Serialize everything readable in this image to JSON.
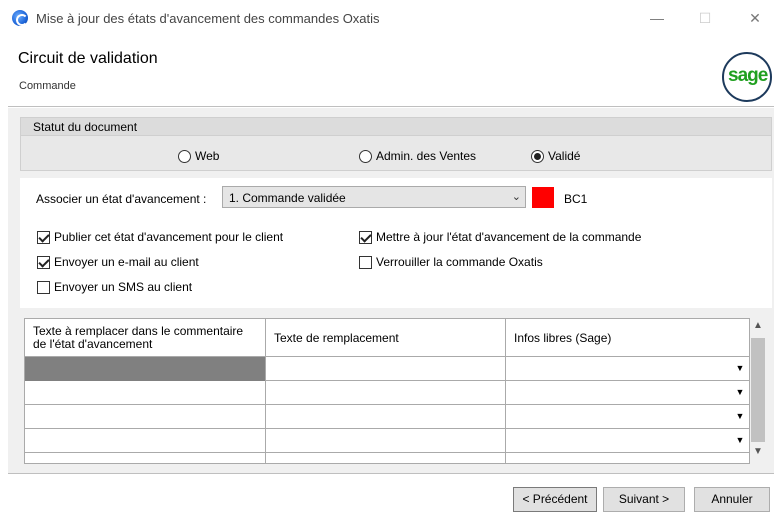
{
  "window": {
    "title": "Mise à jour des états d'avancement des commandes Oxatis",
    "minimize": "—",
    "maximize": "☐",
    "close": "✕"
  },
  "header": {
    "title": "Circuit de validation",
    "subtitle": "Commande",
    "logo_text": "sage"
  },
  "status": {
    "heading": "Statut du document",
    "options": [
      {
        "label": "Web",
        "checked": false
      },
      {
        "label": "Admin. des Ventes",
        "checked": false
      },
      {
        "label": "Validé",
        "checked": true
      }
    ]
  },
  "associate": {
    "label": "Associer un état d'avancement :",
    "selected": "1. Commande validée",
    "color": "#ff0000",
    "code": "BC1"
  },
  "options": {
    "publish": {
      "label": "Publier cet état d'avancement pour le client",
      "checked": true
    },
    "update": {
      "label": "Mettre à jour l'état d'avancement de la commande",
      "checked": true
    },
    "email": {
      "label": "Envoyer un e-mail au client",
      "checked": true
    },
    "lock": {
      "label": "Verrouiller la commande Oxatis",
      "checked": false
    },
    "sms": {
      "label": "Envoyer un SMS au client",
      "checked": false
    }
  },
  "grid": {
    "columns": [
      "Texte à remplacer dans le commentaire de l'état d'avancement",
      "Texte de remplacement",
      "Infos libres (Sage)"
    ],
    "rows": [
      [
        "",
        "",
        ""
      ],
      [
        "",
        "",
        ""
      ],
      [
        "",
        "",
        ""
      ],
      [
        "",
        "",
        ""
      ]
    ]
  },
  "buttons": {
    "prev": "< Précédent",
    "next": "Suivant >",
    "cancel": "Annuler"
  }
}
